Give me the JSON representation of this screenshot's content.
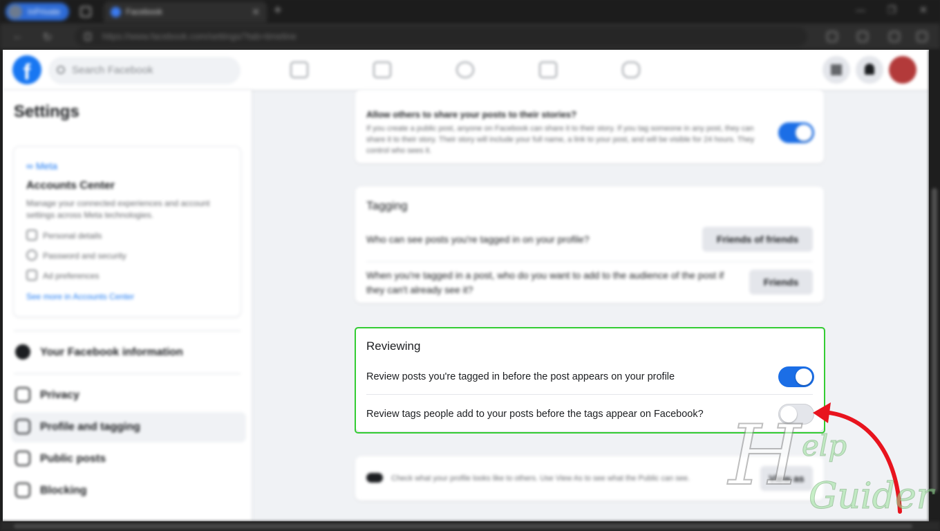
{
  "browser": {
    "profile_label": "InPrivate",
    "tab_title": "Facebook",
    "tab_close": "✕",
    "new_tab": "+",
    "url": "https://www.facebook.com/settings/?tab=timeline",
    "window_controls": [
      "—",
      "❐",
      "✕"
    ]
  },
  "header": {
    "logo": "f",
    "search_placeholder": "Search Facebook"
  },
  "sidebar": {
    "title": "Settings",
    "accounts_center": {
      "brand": "∞ Meta",
      "title": "Accounts Center",
      "description": "Manage your connected experiences and account settings across Meta technologies.",
      "items": [
        "Personal details",
        "Password and security",
        "Ad preferences"
      ],
      "link": "See more in Accounts Center"
    },
    "items": [
      {
        "label": "Your Facebook information",
        "icon": "facebook-icon"
      },
      {
        "label": "Privacy",
        "icon": "lock-icon"
      },
      {
        "label": "Profile and tagging",
        "icon": "tag-icon",
        "active": true
      },
      {
        "label": "Public posts",
        "icon": "public-posts-icon"
      },
      {
        "label": "Blocking",
        "icon": "block-user-icon"
      }
    ]
  },
  "stories_card": {
    "question": "Allow others to share your posts to their stories?",
    "description": "If you create a public post, anyone on Facebook can share it to their story. If you tag someone in any post, they can share it to their story. Their story will include your full name, a link to your post, and will be visible for 24 hours. They control who sees it.",
    "toggle_on": true
  },
  "tagging_card": {
    "title": "Tagging",
    "rows": [
      {
        "label": "Who can see posts you're tagged in on your profile?",
        "button": "Friends of friends"
      },
      {
        "label": "When you're tagged in a post, who do you want to add to the audience of the post if they can't already see it?",
        "button": "Friends"
      }
    ]
  },
  "reviewing_card": {
    "title": "Reviewing",
    "rows": [
      {
        "label": "Review posts you're tagged in before the post appears on your profile",
        "toggle_on": true
      },
      {
        "label": "Review tags people add to your posts before the tags appear on Facebook?",
        "toggle_on": false
      }
    ]
  },
  "view_as_card": {
    "text": "Check what your profile looks like to others. Use View As to see what the Public can see.",
    "button": "View as"
  },
  "watermark": {
    "text_a": "H",
    "text_b": "elp",
    "text_c": "Guider"
  },
  "colors": {
    "accent": "#1877f2",
    "toggle_on": "#1b6ee6",
    "highlight": "#33cc33",
    "arrow": "#e8141e"
  }
}
